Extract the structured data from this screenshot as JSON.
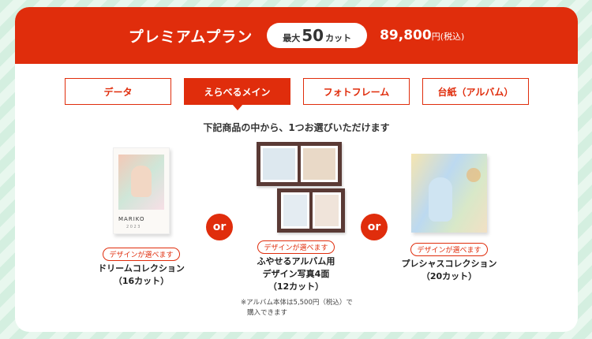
{
  "header": {
    "title": "プレミアムプラン",
    "max_prefix": "最大",
    "max_value": "50",
    "max_unit": "カット",
    "price": "89,800",
    "price_unit": "円(税込)"
  },
  "tabs": [
    {
      "label": "データ",
      "active": false
    },
    {
      "label": "えらべるメイン",
      "active": true
    },
    {
      "label": "フォトフレーム",
      "active": false
    },
    {
      "label": "台紙（アルバム）",
      "active": false
    }
  ],
  "instruction": "下記商品の中から、1つお選びいただけます",
  "products": [
    {
      "badge": "デザインが選べます",
      "name_lines": [
        "ドリームコレクション",
        "（16カット）"
      ],
      "cover_text": "MARIKO",
      "cover_year": "2 0 2 3"
    },
    {
      "badge": "デザインが選べます",
      "name_lines": [
        "ふやせるアルバム用",
        "デザイン写真4面",
        "（12カット）"
      ],
      "note_lines": [
        "※アルバム本体は5,500円（税込）で",
        "購入できます"
      ]
    },
    {
      "badge": "デザインが選べます",
      "name_lines": [
        "プレシャスコレクション",
        "（20カット）"
      ]
    }
  ],
  "or_label": "or",
  "colors": {
    "accent": "#e02d0c",
    "background": "#d4efe0"
  }
}
